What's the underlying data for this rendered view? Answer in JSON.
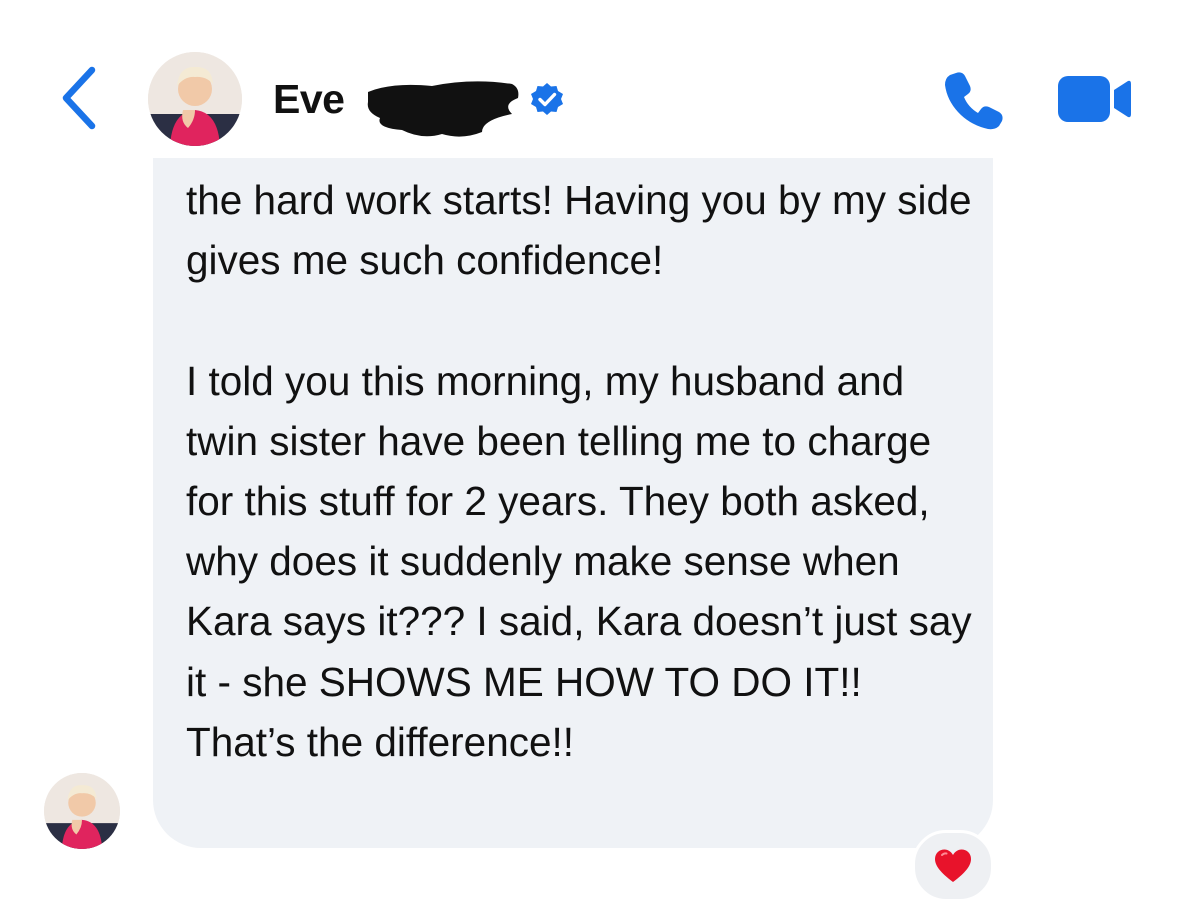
{
  "header": {
    "contact_name": "Eve",
    "back_icon": "chevron-left-icon",
    "verified_icon": "verified-badge-icon",
    "call_icon": "phone-icon",
    "video_icon": "video-camera-icon",
    "accent_color": "#1a73e8"
  },
  "message": {
    "paragraphs": [
      "the hard work starts! Having you by my side gives me such confidence!",
      "I told you this morning, my husband and twin sister have been telling me to charge for this stuff for 2 years. They both asked, why does it suddenly make sense when Kara says it??? I said, Kara doesn’t just say it - she SHOWS ME HOW TO DO IT!! That’s the difference!!"
    ],
    "bubble_color": "#eff2f6"
  },
  "reaction": {
    "emoji": "❤️",
    "icon": "heart-icon"
  }
}
